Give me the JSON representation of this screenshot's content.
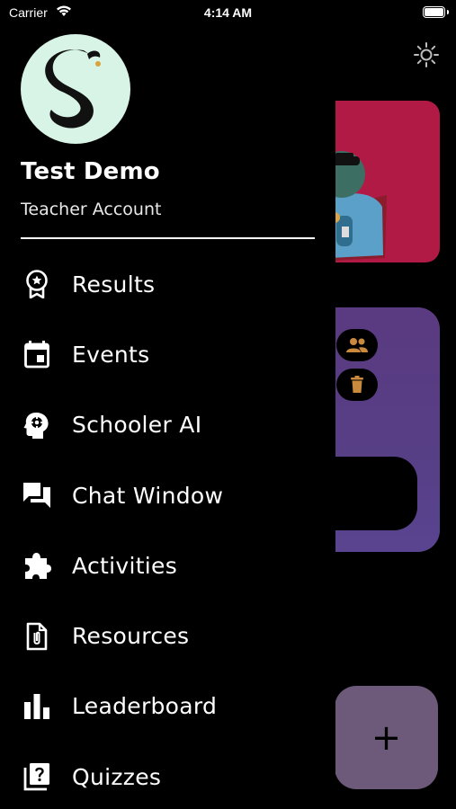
{
  "status_bar": {
    "carrier": "Carrier",
    "time": "4:14 AM",
    "battery_level": 1.0
  },
  "user": {
    "name": "Test Demo",
    "role": "Teacher Account",
    "avatar_icon": "schooler-logo-icon"
  },
  "menu": {
    "items": [
      {
        "label": "Results",
        "icon": "award-ribbon-icon"
      },
      {
        "label": "Events",
        "icon": "calendar-icon"
      },
      {
        "label": "Schooler AI",
        "icon": "head-gear-icon"
      },
      {
        "label": "Chat Window",
        "icon": "chat-bubbles-icon"
      },
      {
        "label": "Activities",
        "icon": "puzzle-piece-icon"
      },
      {
        "label": "Resources",
        "icon": "document-clip-icon"
      },
      {
        "label": "Leaderboard",
        "icon": "bar-chart-icon"
      },
      {
        "label": "Quizzes",
        "icon": "quiz-help-icon"
      }
    ]
  },
  "background": {
    "fab_label": "+",
    "colors": {
      "card_red": "#b21a46",
      "card_purple": "#573f86",
      "icon_accent": "#c98a3d",
      "avatar_bg": "#d7f4e6"
    }
  }
}
